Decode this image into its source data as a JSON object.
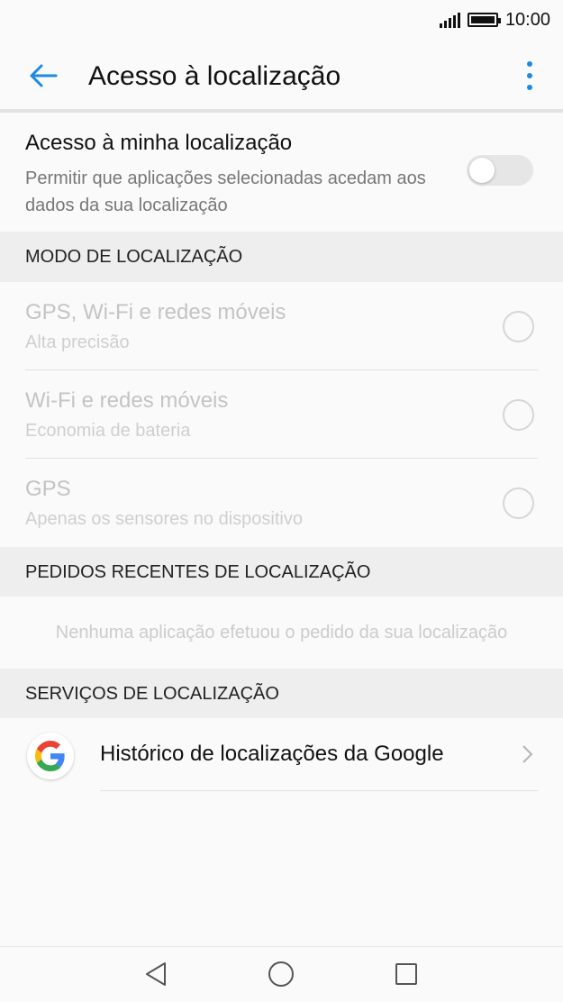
{
  "status_bar": {
    "time": "10:00",
    "signal_icon": "signal-icon",
    "battery_icon": "battery-icon"
  },
  "app_bar": {
    "title": "Acesso à localização",
    "back_icon": "arrow-back-icon",
    "menu_icon": "more-vert-icon"
  },
  "location_access": {
    "title": "Acesso à minha localização",
    "subtitle": "Permitir que aplicações selecionadas acedam aos dados da sua localização",
    "enabled": false
  },
  "sections": {
    "mode_header": "MODO DE LOCALIZAÇÃO",
    "recent_header": "PEDIDOS RECENTES DE LOCALIZAÇÃO",
    "services_header": "SERVIÇOS DE LOCALIZAÇÃO"
  },
  "modes": [
    {
      "title": "GPS, Wi-Fi e redes móveis",
      "subtitle": "Alta precisão"
    },
    {
      "title": "Wi-Fi e redes móveis",
      "subtitle": "Economia de bateria"
    },
    {
      "title": "GPS",
      "subtitle": "Apenas os sensores no dispositivo"
    }
  ],
  "recent_requests": {
    "empty_text": "Nenhuma aplicação efetuou o pedido da sua localização"
  },
  "services": [
    {
      "label": "Histórico de localizações da Google",
      "icon": "google-icon"
    }
  ],
  "colors": {
    "accent": "#1e88e5",
    "header_bg": "#eeeeee",
    "disabled_text": "#c4c4c4"
  }
}
